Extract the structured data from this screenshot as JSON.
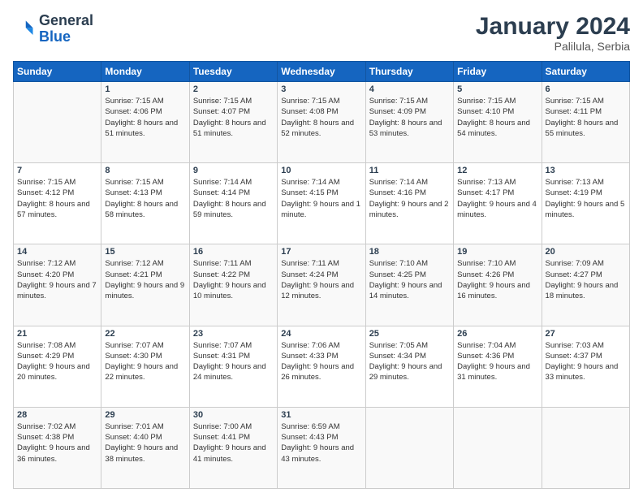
{
  "header": {
    "logo_general": "General",
    "logo_blue": "Blue",
    "title": "January 2024",
    "subtitle": "Palilula, Serbia"
  },
  "days_of_week": [
    "Sunday",
    "Monday",
    "Tuesday",
    "Wednesday",
    "Thursday",
    "Friday",
    "Saturday"
  ],
  "weeks": [
    [
      {
        "day": "",
        "sunrise": "",
        "sunset": "",
        "daylight": ""
      },
      {
        "day": "1",
        "sunrise": "Sunrise: 7:15 AM",
        "sunset": "Sunset: 4:06 PM",
        "daylight": "Daylight: 8 hours and 51 minutes."
      },
      {
        "day": "2",
        "sunrise": "Sunrise: 7:15 AM",
        "sunset": "Sunset: 4:07 PM",
        "daylight": "Daylight: 8 hours and 51 minutes."
      },
      {
        "day": "3",
        "sunrise": "Sunrise: 7:15 AM",
        "sunset": "Sunset: 4:08 PM",
        "daylight": "Daylight: 8 hours and 52 minutes."
      },
      {
        "day": "4",
        "sunrise": "Sunrise: 7:15 AM",
        "sunset": "Sunset: 4:09 PM",
        "daylight": "Daylight: 8 hours and 53 minutes."
      },
      {
        "day": "5",
        "sunrise": "Sunrise: 7:15 AM",
        "sunset": "Sunset: 4:10 PM",
        "daylight": "Daylight: 8 hours and 54 minutes."
      },
      {
        "day": "6",
        "sunrise": "Sunrise: 7:15 AM",
        "sunset": "Sunset: 4:11 PM",
        "daylight": "Daylight: 8 hours and 55 minutes."
      }
    ],
    [
      {
        "day": "7",
        "sunrise": "Sunrise: 7:15 AM",
        "sunset": "Sunset: 4:12 PM",
        "daylight": "Daylight: 8 hours and 57 minutes."
      },
      {
        "day": "8",
        "sunrise": "Sunrise: 7:15 AM",
        "sunset": "Sunset: 4:13 PM",
        "daylight": "Daylight: 8 hours and 58 minutes."
      },
      {
        "day": "9",
        "sunrise": "Sunrise: 7:14 AM",
        "sunset": "Sunset: 4:14 PM",
        "daylight": "Daylight: 8 hours and 59 minutes."
      },
      {
        "day": "10",
        "sunrise": "Sunrise: 7:14 AM",
        "sunset": "Sunset: 4:15 PM",
        "daylight": "Daylight: 9 hours and 1 minute."
      },
      {
        "day": "11",
        "sunrise": "Sunrise: 7:14 AM",
        "sunset": "Sunset: 4:16 PM",
        "daylight": "Daylight: 9 hours and 2 minutes."
      },
      {
        "day": "12",
        "sunrise": "Sunrise: 7:13 AM",
        "sunset": "Sunset: 4:17 PM",
        "daylight": "Daylight: 9 hours and 4 minutes."
      },
      {
        "day": "13",
        "sunrise": "Sunrise: 7:13 AM",
        "sunset": "Sunset: 4:19 PM",
        "daylight": "Daylight: 9 hours and 5 minutes."
      }
    ],
    [
      {
        "day": "14",
        "sunrise": "Sunrise: 7:12 AM",
        "sunset": "Sunset: 4:20 PM",
        "daylight": "Daylight: 9 hours and 7 minutes."
      },
      {
        "day": "15",
        "sunrise": "Sunrise: 7:12 AM",
        "sunset": "Sunset: 4:21 PM",
        "daylight": "Daylight: 9 hours and 9 minutes."
      },
      {
        "day": "16",
        "sunrise": "Sunrise: 7:11 AM",
        "sunset": "Sunset: 4:22 PM",
        "daylight": "Daylight: 9 hours and 10 minutes."
      },
      {
        "day": "17",
        "sunrise": "Sunrise: 7:11 AM",
        "sunset": "Sunset: 4:24 PM",
        "daylight": "Daylight: 9 hours and 12 minutes."
      },
      {
        "day": "18",
        "sunrise": "Sunrise: 7:10 AM",
        "sunset": "Sunset: 4:25 PM",
        "daylight": "Daylight: 9 hours and 14 minutes."
      },
      {
        "day": "19",
        "sunrise": "Sunrise: 7:10 AM",
        "sunset": "Sunset: 4:26 PM",
        "daylight": "Daylight: 9 hours and 16 minutes."
      },
      {
        "day": "20",
        "sunrise": "Sunrise: 7:09 AM",
        "sunset": "Sunset: 4:27 PM",
        "daylight": "Daylight: 9 hours and 18 minutes."
      }
    ],
    [
      {
        "day": "21",
        "sunrise": "Sunrise: 7:08 AM",
        "sunset": "Sunset: 4:29 PM",
        "daylight": "Daylight: 9 hours and 20 minutes."
      },
      {
        "day": "22",
        "sunrise": "Sunrise: 7:07 AM",
        "sunset": "Sunset: 4:30 PM",
        "daylight": "Daylight: 9 hours and 22 minutes."
      },
      {
        "day": "23",
        "sunrise": "Sunrise: 7:07 AM",
        "sunset": "Sunset: 4:31 PM",
        "daylight": "Daylight: 9 hours and 24 minutes."
      },
      {
        "day": "24",
        "sunrise": "Sunrise: 7:06 AM",
        "sunset": "Sunset: 4:33 PM",
        "daylight": "Daylight: 9 hours and 26 minutes."
      },
      {
        "day": "25",
        "sunrise": "Sunrise: 7:05 AM",
        "sunset": "Sunset: 4:34 PM",
        "daylight": "Daylight: 9 hours and 29 minutes."
      },
      {
        "day": "26",
        "sunrise": "Sunrise: 7:04 AM",
        "sunset": "Sunset: 4:36 PM",
        "daylight": "Daylight: 9 hours and 31 minutes."
      },
      {
        "day": "27",
        "sunrise": "Sunrise: 7:03 AM",
        "sunset": "Sunset: 4:37 PM",
        "daylight": "Daylight: 9 hours and 33 minutes."
      }
    ],
    [
      {
        "day": "28",
        "sunrise": "Sunrise: 7:02 AM",
        "sunset": "Sunset: 4:38 PM",
        "daylight": "Daylight: 9 hours and 36 minutes."
      },
      {
        "day": "29",
        "sunrise": "Sunrise: 7:01 AM",
        "sunset": "Sunset: 4:40 PM",
        "daylight": "Daylight: 9 hours and 38 minutes."
      },
      {
        "day": "30",
        "sunrise": "Sunrise: 7:00 AM",
        "sunset": "Sunset: 4:41 PM",
        "daylight": "Daylight: 9 hours and 41 minutes."
      },
      {
        "day": "31",
        "sunrise": "Sunrise: 6:59 AM",
        "sunset": "Sunset: 4:43 PM",
        "daylight": "Daylight: 9 hours and 43 minutes."
      },
      {
        "day": "",
        "sunrise": "",
        "sunset": "",
        "daylight": ""
      },
      {
        "day": "",
        "sunrise": "",
        "sunset": "",
        "daylight": ""
      },
      {
        "day": "",
        "sunrise": "",
        "sunset": "",
        "daylight": ""
      }
    ]
  ]
}
